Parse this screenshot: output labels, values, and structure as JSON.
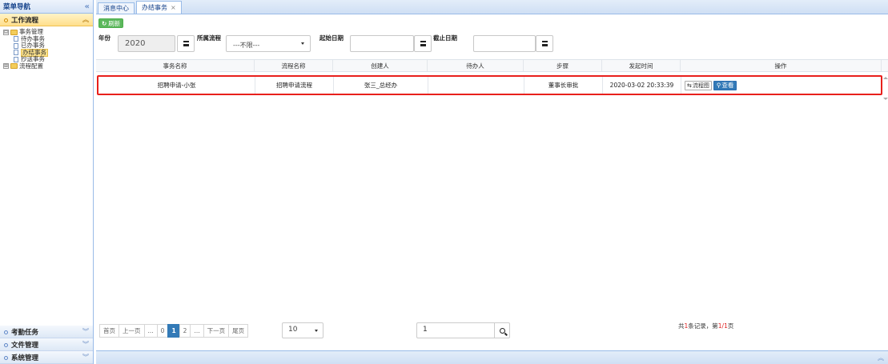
{
  "sidebar": {
    "title": "菜单导航",
    "collapse_icon": "double-chevron-left-icon",
    "active_section": "工作流程",
    "tree": [
      {
        "label": "事务管理",
        "level": 1,
        "type": "folder",
        "expander": "⊟"
      },
      {
        "label": "待办事务",
        "level": 2,
        "type": "doc"
      },
      {
        "label": "已办事务",
        "level": 2,
        "type": "doc"
      },
      {
        "label": "办结事务",
        "level": 2,
        "type": "doc",
        "selected": true
      },
      {
        "label": "抄送事务",
        "level": 2,
        "type": "doc"
      },
      {
        "label": "流程配置",
        "level": 1,
        "type": "folder",
        "expander": "⊞"
      }
    ],
    "bottom_sections": [
      "考勤任务",
      "文件管理",
      "系统管理"
    ]
  },
  "tabs": [
    {
      "label": "消息中心",
      "closable": false,
      "active": false
    },
    {
      "label": "办结事务",
      "closable": true,
      "active": true,
      "close": "×"
    }
  ],
  "toolbar": {
    "refresh_label": "刷新",
    "refresh_icon": "↻",
    "refresh_color": "#5cb85c"
  },
  "filters": {
    "year_label": "年份",
    "year_value": "2020",
    "process_label": "所属流程",
    "process_value": "---不限---",
    "start_date_label": "起始日期",
    "start_date_value": "",
    "end_date_label": "截止日期",
    "end_date_value": ""
  },
  "table": {
    "columns": [
      "事务名称",
      "流程名称",
      "创建人",
      "待办人",
      "步骤",
      "发起时间",
      "操作"
    ],
    "rows": [
      {
        "name": "招聘申请-小张",
        "process": "招聘申请流程",
        "creator": "张三_总经办",
        "assignee": "",
        "step": "董事长审批",
        "start_time": "2020-03-02 20:33:39",
        "flow_btn": "流程图",
        "view_btn": "查看"
      }
    ],
    "highlight_color": "#e8201c"
  },
  "pager": {
    "first": "首页",
    "prev": "上一页",
    "ellipsis": "...",
    "pages": [
      "0",
      "1",
      "2"
    ],
    "current": "1",
    "next": "下一页",
    "last": "尾页",
    "page_size": "10",
    "jump_value": "1",
    "summary_prefix": "共",
    "summary_count": "1",
    "summary_mid": "条记录，第",
    "summary_page": "1/1",
    "summary_suffix": "页"
  },
  "colors": {
    "accent": "#337ab7",
    "border": "#99bbe8",
    "active_menu": "#ffdf8c"
  }
}
